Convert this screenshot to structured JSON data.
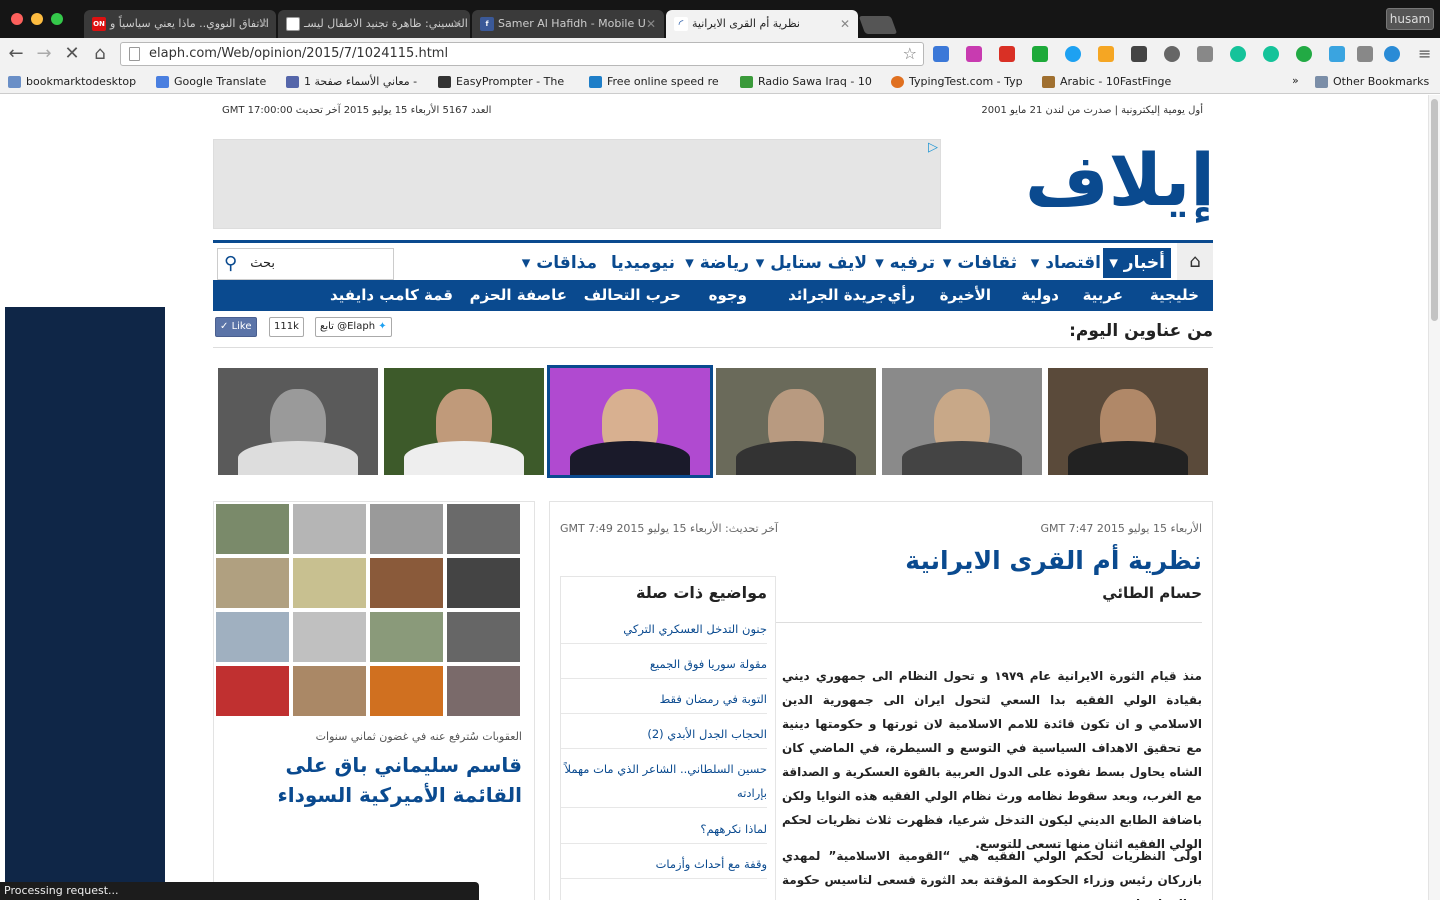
{
  "browser": {
    "tabs": [
      {
        "title": "الاتفاق النووي.. ماذا يعني سياسياً و",
        "fav": "ON",
        "favcolor": "#d11"
      },
      {
        "title": "الحسيني: ظاهرة تجنيد الاطفال ليسـ",
        "fav": "",
        "favcolor": "#fff"
      },
      {
        "title": "Samer Al Hafidh - Mobile U",
        "fav": "f",
        "favcolor": "#3b5998"
      },
      {
        "title": "نظرية أم القرى الايرانية",
        "fav": "",
        "favcolor": "#fff"
      }
    ],
    "user": "husam",
    "url": "elaph.com/Web/opinion/2015/7/1024115.html",
    "bookmarks": [
      "bookmarktodesktop",
      "Google Translate",
      "معاني الأسماء صفحة 1 -",
      "EasyPrompter - The",
      "Free online speed re",
      "Radio Sawa Iraq - 10",
      "TypingTest.com - Typ",
      "Arabic - 10FastFinge"
    ],
    "other_bookmarks": "Other Bookmarks",
    "more": "»",
    "status": "Processing request..."
  },
  "site": {
    "topline_right": "أول يومية إليكترونية | صدرت من لندن 21 مايو 2001",
    "topline_left": "العدد 5167 الأربعاء 15 يوليو 2015 آخر تحديث GMT 17:00:00",
    "logo": "إيلاف",
    "home_icon": "⌂",
    "nav": [
      "أخبار",
      "اقتصاد",
      "ثقافات",
      "ترفيه",
      "لايف ستايل",
      "رياضة",
      "نيوميديا",
      "مذاقات"
    ],
    "nav_arrow": "▾",
    "search_label": "بحث",
    "subnav": [
      "خليجية",
      "عربية",
      "دولية",
      "الأخيرة",
      "رأي",
      "جريدة الجرائد",
      "وجوه",
      "حرب التحالف",
      "عاصفة الحزم",
      "قمة كامب دايفيد"
    ],
    "today_heading": "من عناوين اليوم:",
    "like_label": "Like",
    "like_count": "111k",
    "follow_label": "تابع @Elaph"
  },
  "left": {
    "caption": "العقوبات سُترفع عنه في غضون ثماني سنوات",
    "headline": "قاسم سليماني باق على القائمة الأميركية السوداء"
  },
  "article": {
    "date_published": "الأربعاء 15 يوليو 2015 GMT 7:47",
    "date_updated": "آخر تحديث: الأربعاء 15 يوليو 2015 GMT 7:49",
    "title": "نظرية أم القرى الايرانية",
    "author": "حسام الطائي",
    "para1": "منذ قيام الثورة الايرانية عام ١٩٧٩ و تحول النظام الى جمهوري ديني بقيادة الولي الفقيه بدا السعي لتحول ايران الى جمهورية الدين الاسلامي و ان تكون قائدة للامم الاسلامية لان ثورتها و حكومتها دينية مع تحقيق الاهداف السياسية في التوسع و السيطرة، في الماضي كان الشاه يحاول بسط نفوذه على الدول العربية بالقوة العسكرية و الصداقة مع الغرب، وبعد سقوط نظامه ورث نظام الولي الفقيه هذه النوايا ولكن باضافة الطابع الديني ليكون التدخل شرعيا، فظهرت ثلاث نظريات لحكم الولي الفقيه اثنان منها تسعى للتوسع.",
    "para2": "اولى النظريات لحكم الولي الفقيه هي “القومية الاسلامية” لمهدي بازركان رئيس وزراء الحكومة المؤقتة بعد الثورة فسعى لتاسيس حكومة موالية لسياسة"
  },
  "related": {
    "heading": "مواضيع ذات صلة",
    "items": [
      "جنون التدخل العسكري التركي",
      "مقولة سوريا فوق الجميع",
      "التوبة في رمضان فقط",
      "الحجاب الجدل الأبدي (2)",
      "حسين السلطاني.. الشاعر الذي مات مهملاً بإرادته",
      "لماذا نكرههم؟",
      "وقفة مع أحداث وأزمات"
    ]
  }
}
